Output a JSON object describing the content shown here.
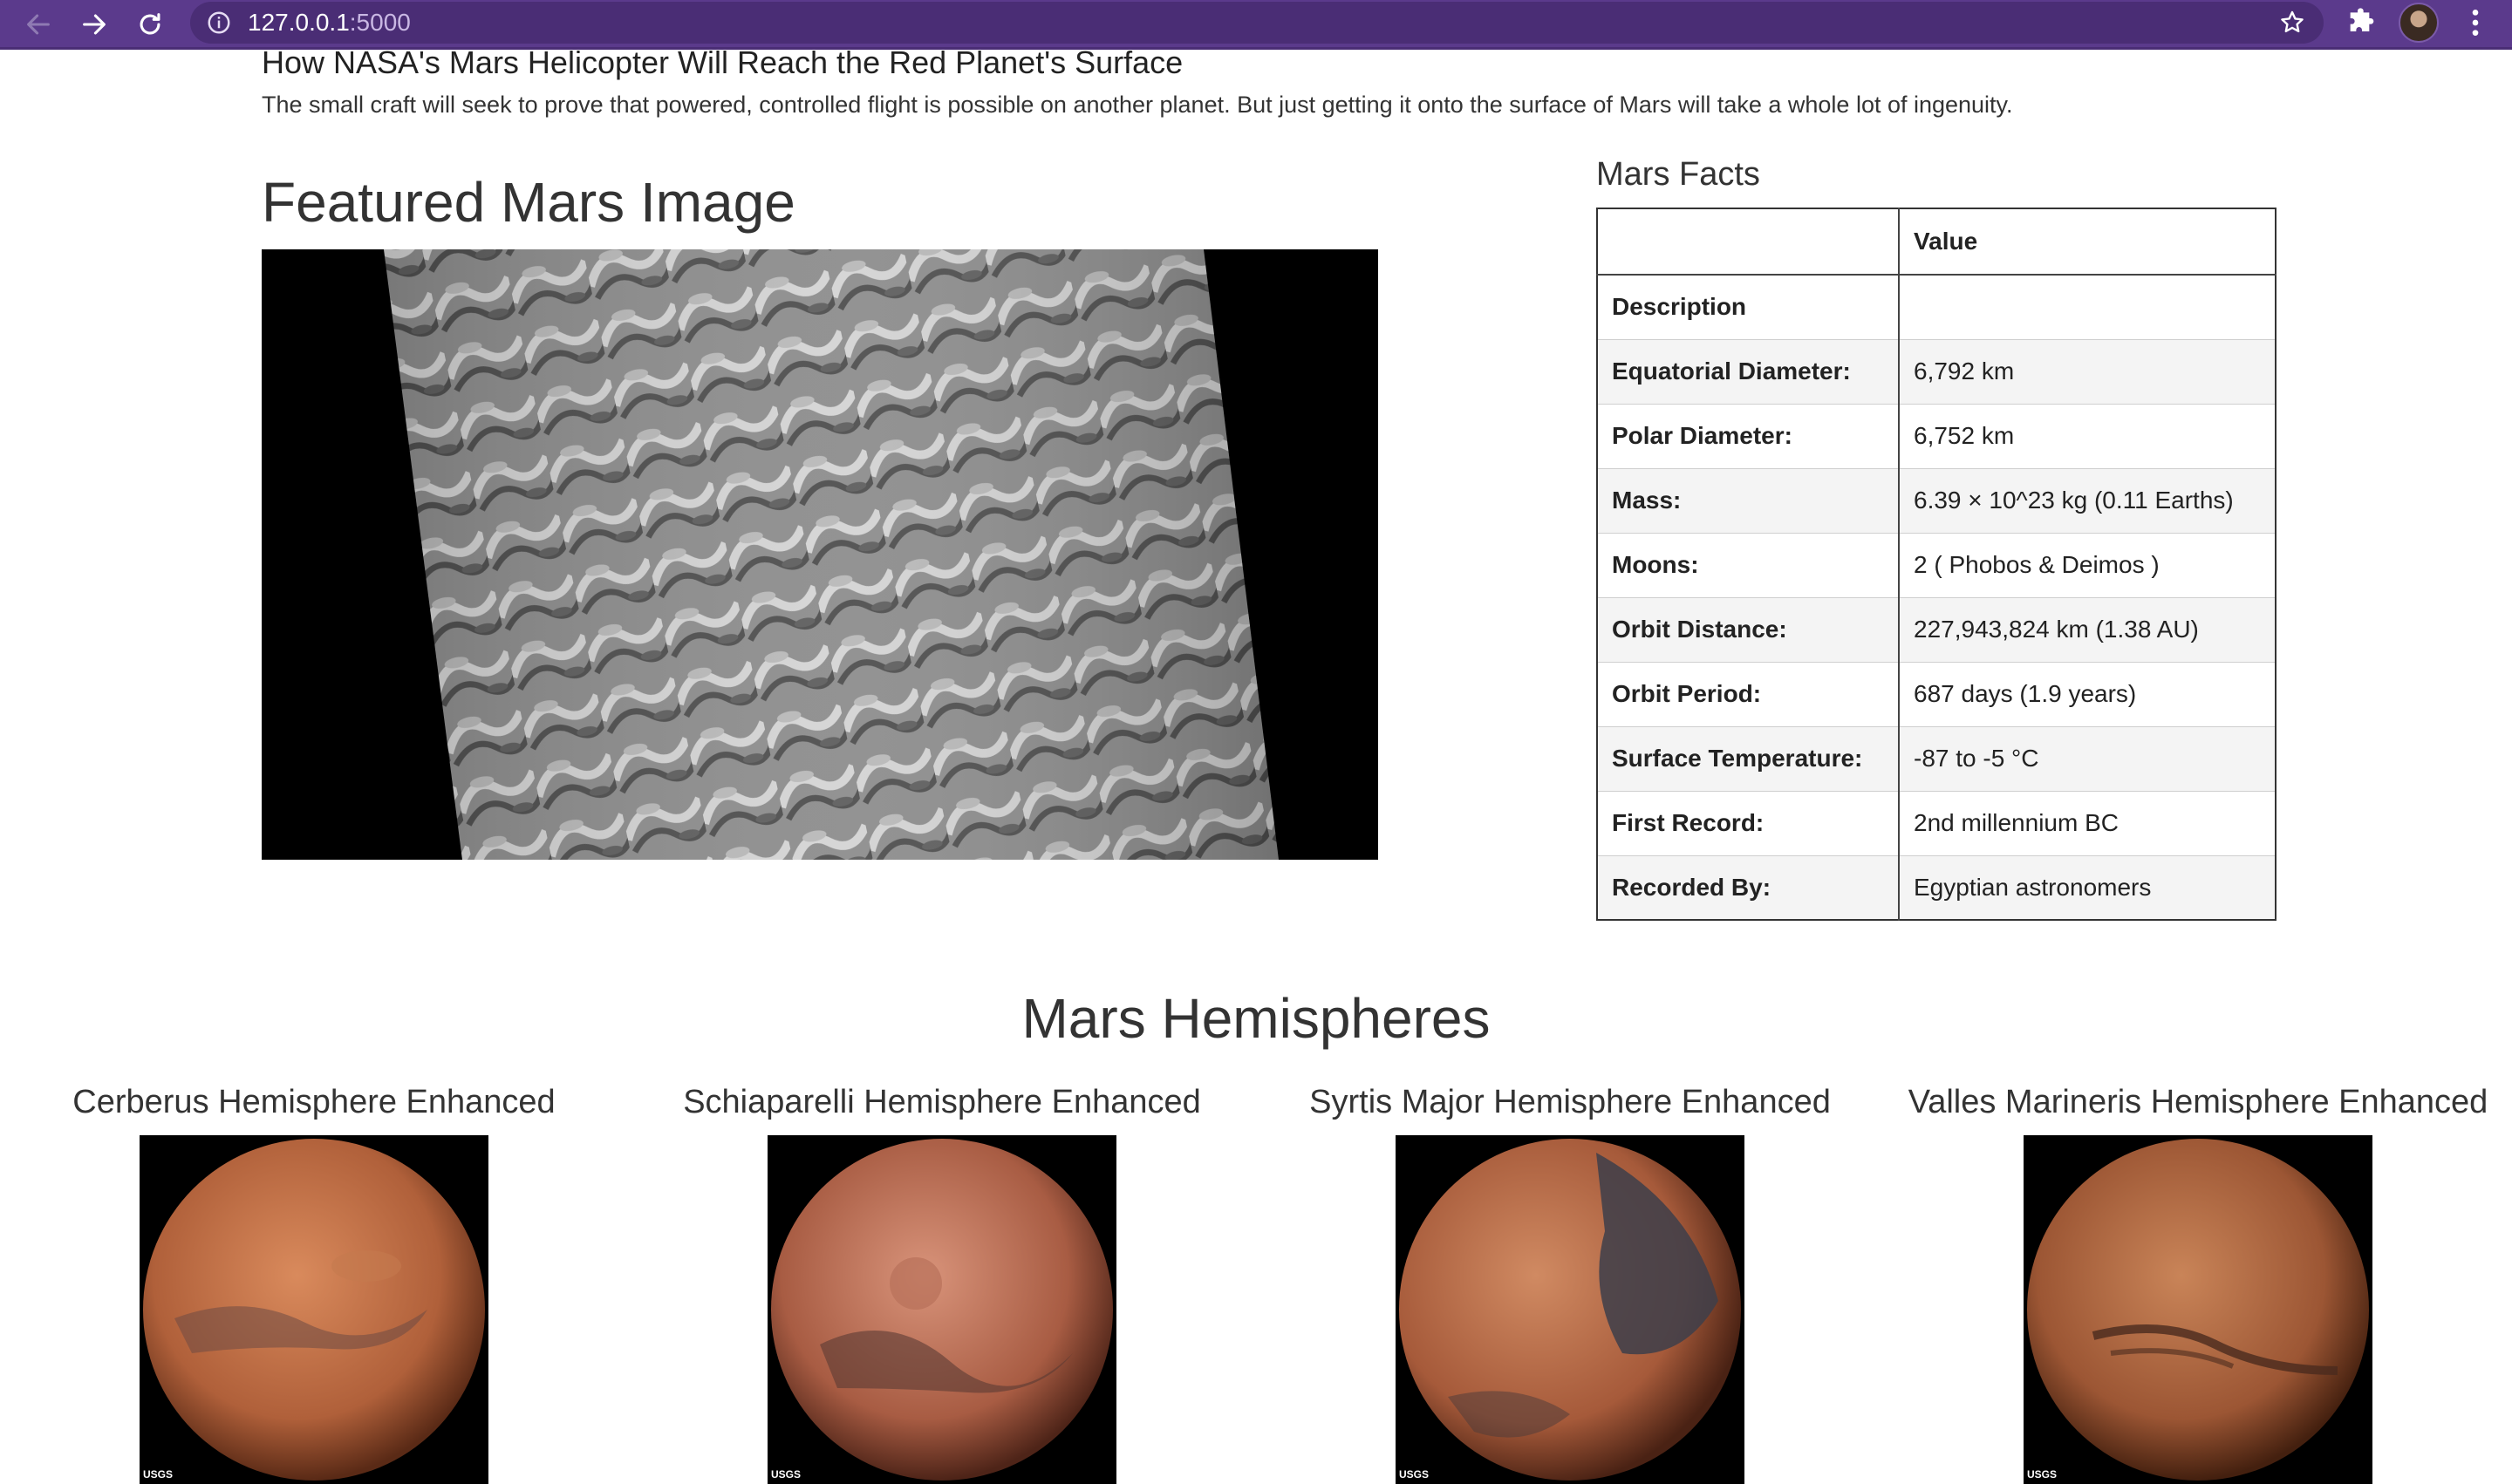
{
  "browser": {
    "url_host": "127.0.0.1",
    "url_port": ":5000",
    "icons": [
      "back-arrow-icon",
      "forward-arrow-icon",
      "reload-icon",
      "info-icon",
      "bookmark-star-icon",
      "extensions-puzzle-icon",
      "profile-avatar",
      "more-menu-icon"
    ],
    "accent_color": "#5b3a8c"
  },
  "news": {
    "title": "How NASA's Mars Helicopter Will Reach the Red Planet's Surface",
    "teaser": "The small craft will seek to prove that powered, controlled flight is possible on another planet. But just getting it onto the surface of Mars will take a whole lot of ingenuity."
  },
  "featured": {
    "heading": "Featured Mars Image"
  },
  "facts": {
    "heading": "Mars Facts",
    "header_col0": "",
    "header_col1": "Value",
    "rows": [
      {
        "label": "Description",
        "value": ""
      },
      {
        "label": "Equatorial Diameter:",
        "value": "6,792 km"
      },
      {
        "label": "Polar Diameter:",
        "value": "6,752 km"
      },
      {
        "label": "Mass:",
        "value": "6.39 × 10^23 kg (0.11 Earths)"
      },
      {
        "label": "Moons:",
        "value": "2 ( Phobos & Deimos )"
      },
      {
        "label": "Orbit Distance:",
        "value": "227,943,824 km (1.38 AU)"
      },
      {
        "label": "Orbit Period:",
        "value": "687 days (1.9 years)"
      },
      {
        "label": "Surface Temperature:",
        "value": "-87 to -5 °C"
      },
      {
        "label": "First Record:",
        "value": "2nd millennium BC"
      },
      {
        "label": "Recorded By:",
        "value": "Egyptian astronomers"
      }
    ]
  },
  "hemispheres": {
    "heading": "Mars Hemispheres",
    "items": [
      {
        "title": "Cerberus Hemisphere Enhanced",
        "badge": "USGS"
      },
      {
        "title": "Schiaparelli Hemisphere Enhanced",
        "badge": "USGS"
      },
      {
        "title": "Syrtis Major Hemisphere Enhanced",
        "badge": "USGS"
      },
      {
        "title": "Valles Marineris Hemisphere Enhanced",
        "badge": "USGS"
      }
    ]
  }
}
